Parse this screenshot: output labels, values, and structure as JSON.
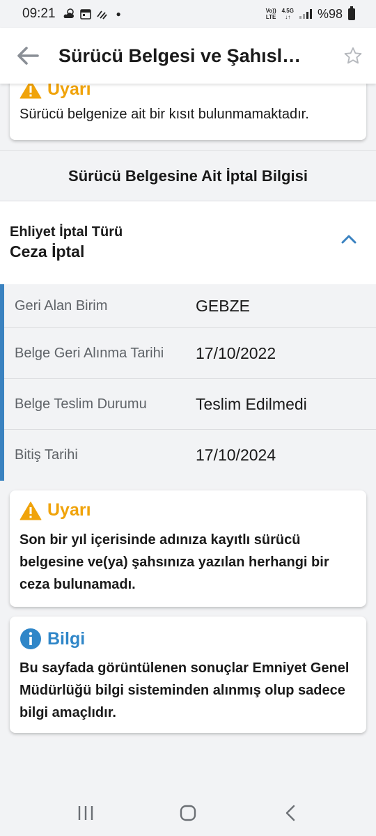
{
  "status_bar": {
    "time": "09:21",
    "network_top": "Vo))",
    "network_bottom": "LTE",
    "network_speed": "4.5G",
    "battery": "%98"
  },
  "app_bar": {
    "title": "Sürücü Belgesi ve Şahısl…",
    "back_icon": "arrow-left-icon",
    "star_icon": "star-outline-icon"
  },
  "warning_top": {
    "heading": "Uyarı",
    "message": "Sürücü belgenize ait bir kısıt bulunmamaktadır."
  },
  "section": {
    "title": "Sürücü Belgesine Ait İptal Bilgisi"
  },
  "accordion": {
    "label": "Ehliyet İptal Türü",
    "value": "Ceza İptal",
    "expanded": true
  },
  "details": [
    {
      "label": "Geri Alan Birim",
      "value": "GEBZE"
    },
    {
      "label": "Belge Geri Alınma Tarihi",
      "value": "17/10/2022"
    },
    {
      "label": "Belge Teslim Durumu",
      "value": "Teslim Edilmedi"
    },
    {
      "label": "Bitiş Tarihi",
      "value": "17/10/2024"
    }
  ],
  "warning_penalty": {
    "heading": "Uyarı",
    "message": "Son bir yıl içerisinde adınıza kayıtlı sürücü belgesine ve(ya) şahsınıza yazılan herhangi bir ceza bulunamadı."
  },
  "info": {
    "heading": "Bilgi",
    "message": "Bu sayfada görüntülenen sonuçlar Emniyet Genel Müdürlüğü bilgi sisteminden alınmış olup sadece bilgi amaçlıdır."
  },
  "colors": {
    "accent": "#3a82c0",
    "warning": "#f0a30a",
    "info": "#2f86c8"
  }
}
